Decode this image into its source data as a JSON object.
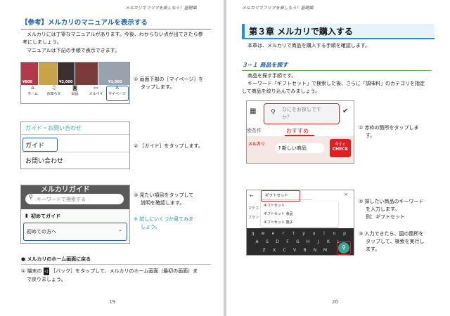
{
  "left": {
    "running_header": "メルカリでフリマを楽しもう！基礎編",
    "ref_heading": "【参考】メルカリのマニュアルを表示する",
    "intro1": "メルカリには丁寧なマニュアルがあります。今後、わからない点が出てきたら参",
    "intro2": "考にしましょう。",
    "intro3": "マニュアルは下記の手順で表示できます。",
    "shot1": {
      "price_labels": [
        "¥800",
        "¥2,000",
        "¥1,000"
      ],
      "tabs": [
        {
          "icon": "⌂",
          "label": "ホーム"
        },
        {
          "icon": "♫",
          "label": "お知らせ"
        },
        {
          "icon": "◙",
          "label": "出品"
        },
        {
          "icon": "▭",
          "label": "メルペイ"
        },
        {
          "icon": "♙",
          "label": "マイページ"
        }
      ]
    },
    "step1_line1": "① 画面下部の［マイページ］を",
    "step1_line2": "タップします。",
    "shot2": {
      "header": "ガイド・お問い合わせ",
      "item1": "ガイド",
      "item2": "お問い合わせ"
    },
    "step2": "② ［ガイド］をタップします。",
    "shot3": {
      "banner": "メルカリガイド",
      "search_placeholder": "キーワードで検索する",
      "section": "初めてガイド",
      "dropdown": "初めての方へ"
    },
    "step3_line1": "③ 見たい項目をタップして",
    "step3_line2": "説明を確認します。",
    "note_line1": "※ 試しにいくつか見てみま",
    "note_line2": "しょう。",
    "home_heading": "● メルカリのホーム画面に戻る",
    "home_body1_a": "① 端末の",
    "home_back_key": "◁",
    "home_body1_b": "［バック］をタップして、メルカリのホーム画面（最初の画面）ま",
    "home_body2": "で戻りましょう。",
    "page_number": "19"
  },
  "right": {
    "running_header": "メルカリでフリマを楽しもう！基礎編",
    "chapter_title": "第３章 メルカリで購入する",
    "chapter_intro": "本章は、メルカリで商品を購入する手順を確認します。",
    "section_title": "３−１ 商品を探す",
    "body1": "商品を探す手順です。",
    "body2": "キーワード「ギフトセット」で検索した後、さらに「調味料」のカテゴリを指定",
    "body3": "して商品を絞り込んでみましょう。",
    "shot4": {
      "search_placeholder_1": "なにをお探しです",
      "search_placeholder_2": "か？",
      "left_tab": "索条件",
      "active_tab": "おすすめ",
      "new_item": "新しい商品",
      "promo": "今すぐ",
      "promo2": "CHECK",
      "festa": "メルカリ"
    },
    "step1_line1": "① 赤枠の箇所をタップしま",
    "step1_line2": "す。",
    "shot5": {
      "query": "ギフトセット",
      "side_label1": "カテゴ",
      "side_label2": "ブラン",
      "suggestions": [
        "ギフトセット",
        "ギフトセット 食品",
        "ギフトセット 菓子"
      ],
      "keys_row1": [
        "q",
        "w",
        "e",
        "r",
        "t",
        "y",
        "u",
        "i",
        "o",
        "p"
      ],
      "keys_row2": [
        "A",
        "S",
        "D",
        "F",
        "G",
        "H",
        "J",
        "K",
        "L"
      ],
      "keys_row3": [
        "Z",
        "X",
        "C",
        "V",
        "B",
        "N",
        "M"
      ]
    },
    "step2_line1": "② 探したい商品のキーワード",
    "step2_line2": "を入力します。",
    "step2_line3": "例：ギフトセット",
    "step3_line1": "③ 入力できたら、図の箇所を",
    "step3_line2": "タップして、検索を実行し",
    "step3_line3": "ます。",
    "page_number": "20"
  },
  "colors": {
    "accent_blue": "#1e5fa6",
    "mercari_red": "#e02020",
    "note_cyan": "#1d8fb8"
  }
}
